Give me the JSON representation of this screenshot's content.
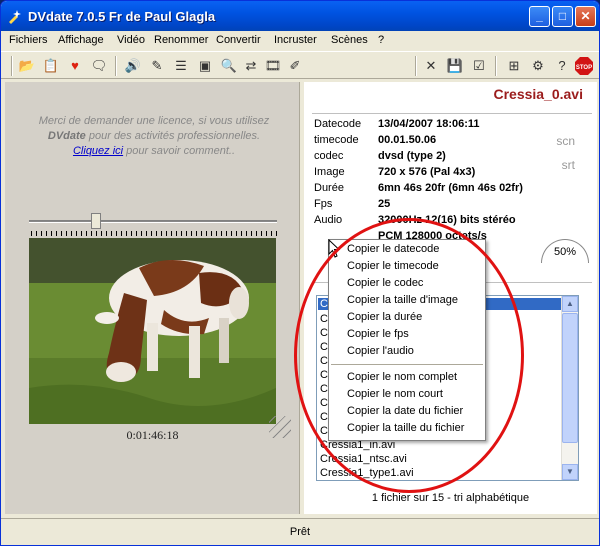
{
  "window": {
    "title": "DVdate 7.0.5 Fr de Paul Glagla"
  },
  "menu": [
    "Fichiers",
    "Affichage",
    "Vidéo",
    "Renommer",
    "Convertir",
    "Incruster",
    "Scènes",
    "?"
  ],
  "license": {
    "line1": "Merci de demander une licence, si vous utilisez",
    "line2_bold": "DVdate",
    "line2_rest": " pour des activités professionnelles.",
    "link": "Cliquez ici",
    "link_rest": " pour savoir comment.."
  },
  "video": {
    "timecode": "0:01:46:18",
    "slider_position": 0.26
  },
  "file": {
    "title": "Cressia_0.avi"
  },
  "info": [
    {
      "label": "Datecode",
      "value": "13/04/2007 18:06:11"
    },
    {
      "label": "timecode",
      "value": "00.01.50.06"
    },
    {
      "label": "codec",
      "value": "dvsd (type 2)"
    },
    {
      "label": "Image",
      "value": "720 x 576 (Pal 4x3)"
    },
    {
      "label": "Durée",
      "value": "6mn 46s 20fr (6mn 46s 02fr)"
    },
    {
      "label": "Fps",
      "value": "25"
    },
    {
      "label": "Audio",
      "value": "32000Hz 12(16) bits  stéréo"
    },
    {
      "label": "",
      "value": "PCM 128000 octets/s"
    }
  ],
  "side_tags": {
    "scn": "scn",
    "srt": "srt"
  },
  "gauge": {
    "value": "50%"
  },
  "file_list": {
    "items": [
      "C",
      "C",
      "C",
      "C",
      "C",
      "C",
      "C",
      "C",
      "C",
      "C",
      "Cressia1_in.avi",
      "Cressia1_ntsc.avi",
      "Cressia1_type1.avi"
    ],
    "selected_index": 0,
    "count_text": "1 fichier sur 15 - tri alphabétique"
  },
  "context_menu": {
    "group1": [
      "Copier le datecode",
      "Copier le timecode",
      "Copier le codec",
      "Copier la taille d'image",
      "Copier la durée",
      "Copier le fps",
      "Copier l'audio"
    ],
    "group2": [
      "Copier le nom complet",
      "Copier le nom court",
      "Copier la date du fichier",
      "Copier la taille du fichier"
    ]
  },
  "status": {
    "text": "Prêt"
  },
  "colors": {
    "titlebar": "#0053e1",
    "accent_title": "#9b1c1c",
    "selection": "#316ac5",
    "annotation": "#e01212"
  },
  "icons": [
    "open-folder-icon",
    "open-files-icon",
    "favorite-icon",
    "comment-icon",
    "speaker-icon",
    "rename-icon",
    "list-icon",
    "window-icon",
    "search-icon",
    "convert-icon",
    "film-icon",
    "edit-icon",
    "close-x-icon",
    "save-icon",
    "checklist-icon",
    "tree-icon",
    "settings-icon",
    "help-icon",
    "stop-icon"
  ]
}
